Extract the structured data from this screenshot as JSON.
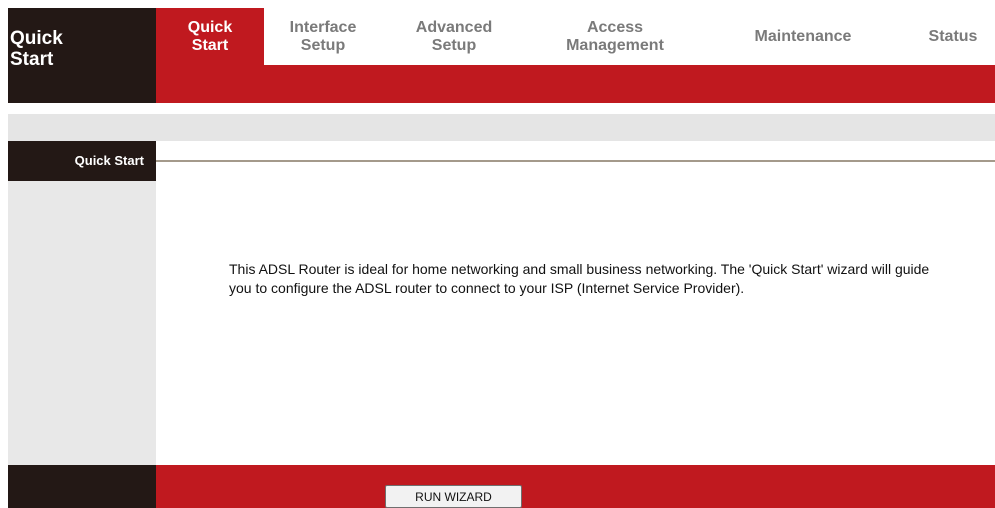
{
  "header": {
    "title": "Quick\nStart"
  },
  "nav": {
    "items": [
      {
        "label": "Quick\nStart",
        "active": true
      },
      {
        "label": "Interface\nSetup",
        "active": false
      },
      {
        "label": "Advanced\nSetup",
        "active": false
      },
      {
        "label": "Access\nManagement",
        "active": false
      },
      {
        "label": "Maintenance",
        "active": false
      },
      {
        "label": "Status",
        "active": false
      }
    ]
  },
  "section": {
    "label": "Quick Start"
  },
  "main": {
    "description": "This ADSL Router is ideal for home networking and small business networking. The 'Quick Start' wizard will guide you to configure the ADSL router to connect to your ISP (Internet Service Provider)."
  },
  "footer": {
    "run_wizard_label": "RUN WIZARD"
  },
  "colors": {
    "brand_red": "#c0191f",
    "dark": "#231815",
    "panel_gray": "#e8e8e8"
  }
}
